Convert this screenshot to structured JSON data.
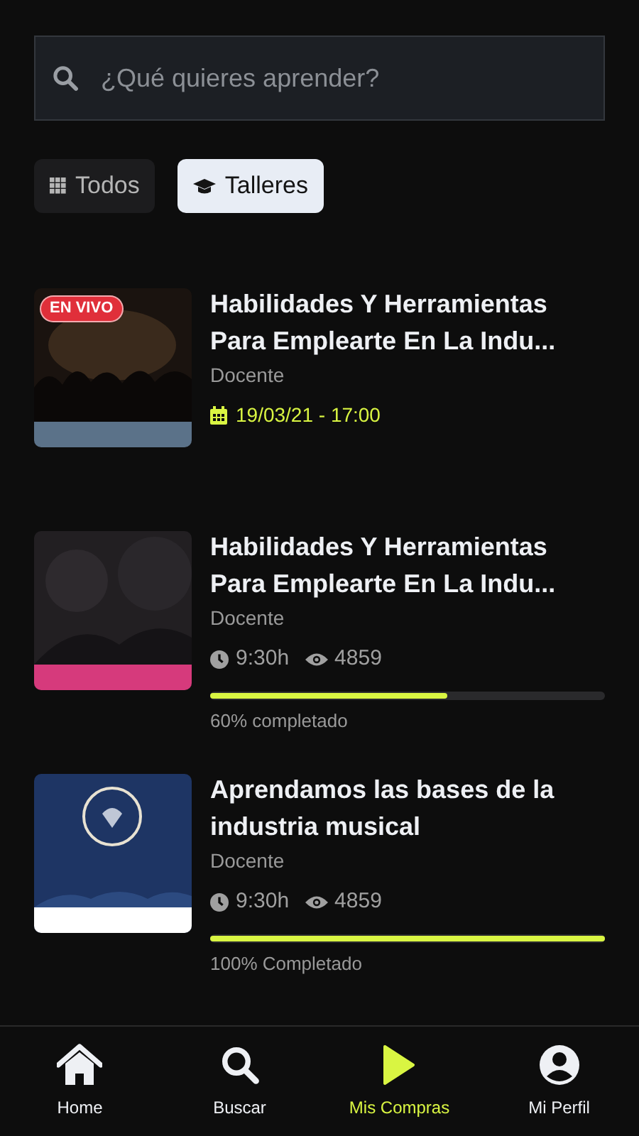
{
  "search": {
    "placeholder": "¿Qué quieres aprender?"
  },
  "filters": [
    {
      "label": "Todos",
      "selected": false
    },
    {
      "label": "Talleres",
      "selected": true
    }
  ],
  "courses": [
    {
      "kind": "scheduled",
      "badge": "EN VIVO",
      "title": "Habilidades Y Herramientas Para Emplearte En La Indu...",
      "subtitle": "Docente",
      "date": "19/03/21 - 17:00"
    },
    {
      "kind": "progress",
      "title": "Habilidades Y Herramientas Para Emplearte En La Indu...",
      "subtitle": "Docente",
      "duration": "9:30h",
      "views": "4859",
      "level": 0.6,
      "progress_label": "60% completado"
    },
    {
      "kind": "progress",
      "title": "Aprendamos las bases de la industria musical",
      "subtitle": "Docente",
      "duration": "9:30h",
      "views": "4859",
      "level": 1,
      "progress_label": "100% Completado"
    }
  ],
  "nav": [
    {
      "label": "Home",
      "selected": false
    },
    {
      "label": "Buscar",
      "selected": false
    },
    {
      "label": "Mis Compras",
      "selected": true
    },
    {
      "label": "Mi Perfil",
      "selected": false
    }
  ]
}
